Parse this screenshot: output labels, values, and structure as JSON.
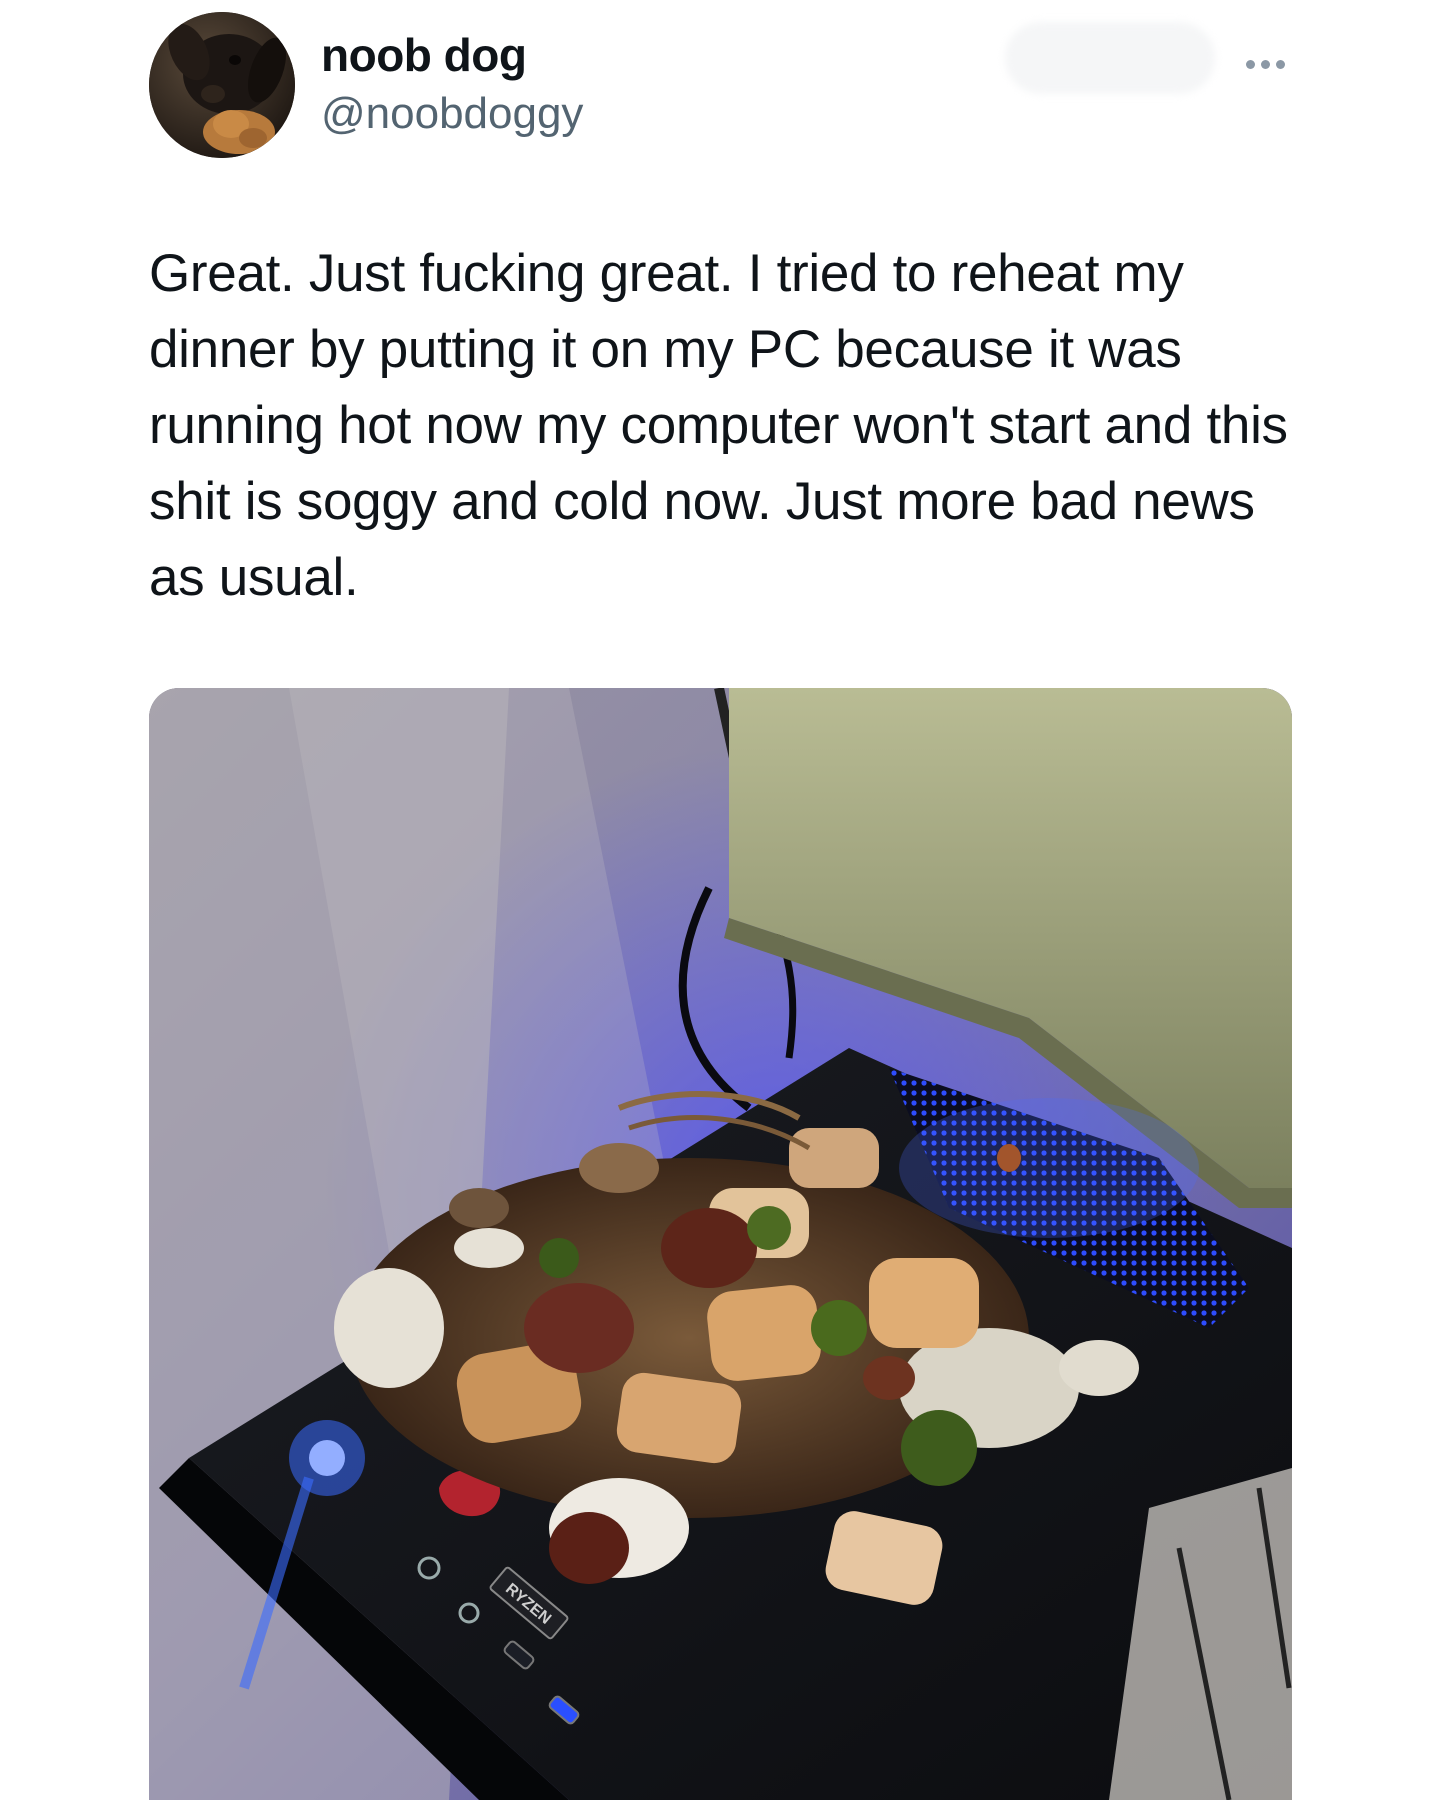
{
  "tweet": {
    "author": {
      "display_name": "noob dog",
      "handle": "@noobdoggy",
      "avatar_icon": "dog-avatar"
    },
    "more_icon": "ellipsis-icon",
    "text": "Great. Just fucking great. I tried to reheat my dinner by putting it on my PC because it was running hot now my computer won't start and this shit is soggy and cold now. Just more bad news as usual.",
    "media": {
      "kind": "photo",
      "case_label": "RYZEN"
    }
  },
  "colors": {
    "text_primary": "#0f1419",
    "text_secondary": "#536471",
    "accent_led": "#3b6cff"
  }
}
